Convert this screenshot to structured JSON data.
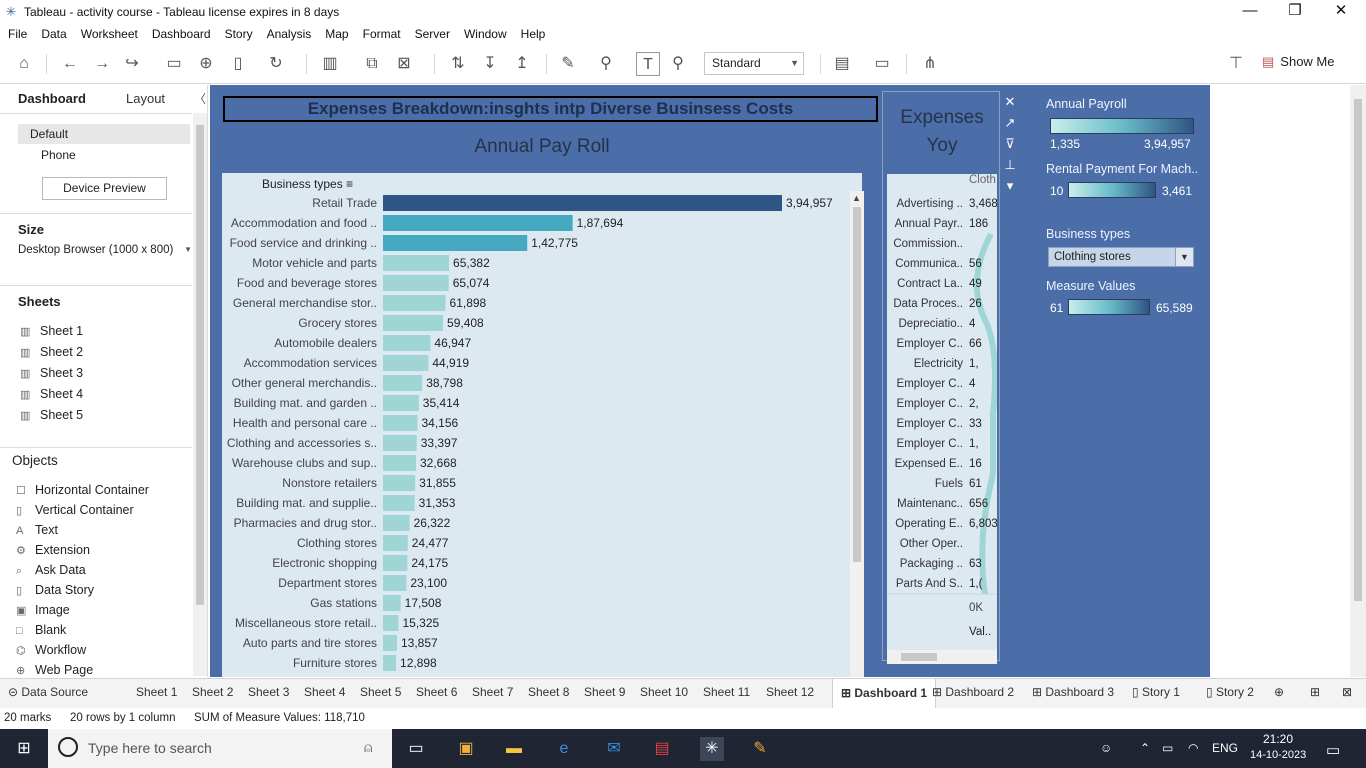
{
  "window": {
    "title": "Tableau - activity course - Tableau license expires in 8 days"
  },
  "menu": [
    "File",
    "Data",
    "Worksheet",
    "Dashboard",
    "Story",
    "Analysis",
    "Map",
    "Format",
    "Server",
    "Window",
    "Help"
  ],
  "toolbar": {
    "view_mode": "Standard",
    "show_me": "Show Me"
  },
  "left_pane": {
    "tabs": {
      "dashboard": "Dashboard",
      "layout": "Layout"
    },
    "devices": [
      "Default",
      "Phone"
    ],
    "device_preview": "Device Preview",
    "size_label": "Size",
    "size_value": "Desktop Browser (1000 x 800)",
    "sheets_label": "Sheets",
    "sheets": [
      "Sheet 1",
      "Sheet 2",
      "Sheet 3",
      "Sheet 4",
      "Sheet 5"
    ],
    "objects_label": "Objects",
    "objects": [
      "Horizontal Container",
      "Vertical Container",
      "Text",
      "Extension",
      "Ask Data",
      "Data Story",
      "Image",
      "Blank",
      "Workflow",
      "Web Page"
    ]
  },
  "dashboard": {
    "title": "Expenses Breakdown:insghts intp Diverse Businsess Costs",
    "chart_title": "Annual Pay Roll",
    "yoy_title": "Expenses Yoy",
    "yoy": {
      "header": "Cloth",
      "labels": [
        "Advertising ..",
        "Annual Payr..",
        "Commission..",
        "Communica..",
        "Contract La..",
        "Data Proces..",
        "Depreciatio..",
        "Employer C..",
        "Electricity",
        "Employer C..",
        "Employer C..",
        "Employer C..",
        "Employer C..",
        "Expensed E..",
        "Fuels",
        "Maintenanc..",
        "Operating E..",
        "Other Oper..",
        "Packaging ..",
        "Parts And S.."
      ],
      "values": [
        "3,468",
        "186",
        "",
        "56",
        "49",
        "26",
        "4",
        "66",
        "1,",
        "4",
        "2,",
        "33",
        "1,",
        "16",
        "61",
        "656",
        "6,803",
        "",
        "63",
        "1,("
      ],
      "axis": "0K",
      "footer": "Val.."
    },
    "legends": {
      "annual_payroll": {
        "title": "Annual Payroll",
        "min": "1,335",
        "max": "3,94,957"
      },
      "rental": {
        "title": "Rental Payment For Mach..",
        "min": "10",
        "max": "3,461"
      },
      "business_types": {
        "title": "Business types",
        "selected": "Clothing stores"
      },
      "measure_values": {
        "title": "Measure Values",
        "min": "61",
        "max": "65,589"
      }
    }
  },
  "chart_data": {
    "type": "bar",
    "title": "Annual Pay Roll",
    "xlabel": "",
    "ylabel": "Business types",
    "categories": [
      "Retail Trade",
      "Accommodation and food ..",
      "Food service and drinking ..",
      "Motor vehicle and parts",
      "Food and beverage stores",
      "General merchandise stor..",
      "Grocery stores",
      "Automobile dealers",
      "Accommodation services",
      "Other general merchandis..",
      "Building mat. and garden ..",
      "Health and personal care ..",
      "Clothing and accessories s..",
      "Warehouse clubs and sup..",
      "Nonstore retailers",
      "Building mat. and supplie..",
      "Pharmacies and drug stor..",
      "Clothing stores",
      "Electronic shopping",
      "Department stores",
      "Gas stations",
      "Miscellaneous store retail..",
      "Auto parts and tire stores",
      "Furniture stores"
    ],
    "values": [
      394957,
      187694,
      142775,
      65382,
      65074,
      61898,
      59408,
      46947,
      44919,
      38798,
      35414,
      34156,
      33397,
      32668,
      31855,
      31353,
      26322,
      24477,
      24175,
      23100,
      17508,
      15325,
      13857,
      12898
    ],
    "labels": [
      "3,94,957",
      "1,87,694",
      "1,42,775",
      "65,382",
      "65,074",
      "61,898",
      "59,408",
      "46,947",
      "44,919",
      "38,798",
      "35,414",
      "34,156",
      "33,397",
      "32,668",
      "31,855",
      "31,353",
      "26,322",
      "24,477",
      "24,175",
      "23,100",
      "17,508",
      "15,325",
      "13,857",
      "12,898"
    ],
    "colors": {
      "max": "#2e5583",
      "mid": "#45a9c1",
      "low": "#9fd6d5"
    }
  },
  "tabs": [
    "Data Source",
    "Sheet 1",
    "Sheet 2",
    "Sheet 3",
    "Sheet 4",
    "Sheet 5",
    "Sheet 6",
    "Sheet 7",
    "Sheet 8",
    "Sheet 9",
    "Sheet 10",
    "Sheet 11",
    "Sheet 12",
    "Dashboard 1",
    "Dashboard 2",
    "Dashboard 3",
    "Story 1",
    "Story 2"
  ],
  "status": {
    "marks": "20 marks",
    "rows": "20 rows by 1 column",
    "sum": "SUM of Measure Values: 118,710"
  },
  "taskbar": {
    "search_placeholder": "Type here to search",
    "lang": "ENG",
    "time": "21:20",
    "date": "14-10-2023"
  }
}
